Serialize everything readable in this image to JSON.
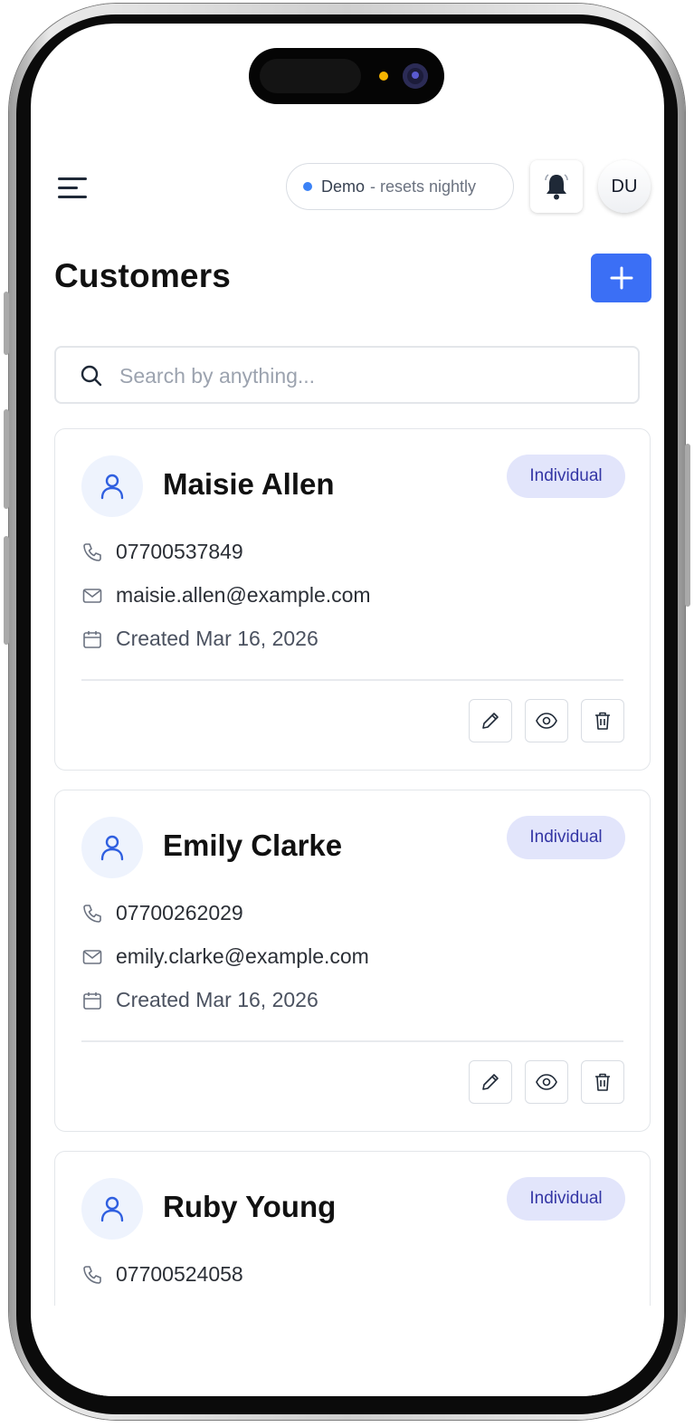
{
  "header": {
    "demo_label": "Demo",
    "demo_sub": "- resets nightly",
    "user_initials": "DU"
  },
  "page": {
    "title": "Customers"
  },
  "search": {
    "placeholder": "Search by anything..."
  },
  "customers": [
    {
      "name": "Maisie Allen",
      "type": "Individual",
      "phone": "07700537849",
      "email": "maisie.allen@example.com",
      "created": "Created Mar 16, 2026"
    },
    {
      "name": "Emily Clarke",
      "type": "Individual",
      "phone": "07700262029",
      "email": "emily.clarke@example.com",
      "created": "Created Mar 16, 2026"
    },
    {
      "name": "Ruby Young",
      "type": "Individual",
      "phone": "07700524058"
    }
  ],
  "colors": {
    "accent": "#3b6ff5",
    "badge_bg": "#e2e5fb",
    "badge_text": "#3436a5",
    "demo_dot": "#3b82f6"
  },
  "icons": {
    "menu": "hamburger-icon",
    "bell": "bell-icon",
    "add": "plus-icon",
    "search": "search-icon",
    "phone": "phone-icon",
    "email": "mail-icon",
    "date": "calendar-icon",
    "edit": "pencil-icon",
    "view": "eye-icon",
    "delete": "trash-icon",
    "customer": "user-icon"
  }
}
